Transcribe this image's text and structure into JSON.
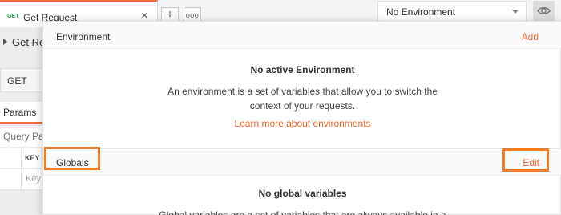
{
  "tab": {
    "method": "GET",
    "title": "Get Request",
    "close": "×",
    "add": "+",
    "more": "ooo"
  },
  "environment_selector": {
    "selected": "No Environment",
    "caret_icon": "caret-down-icon",
    "eye_icon": "eye-icon"
  },
  "request": {
    "name": "Get Req",
    "method": "GET",
    "params_tab": "Params",
    "query_params_label": "Query Par",
    "key_header": "KEY",
    "key_placeholder": "Key"
  },
  "popup": {
    "environment": {
      "title": "Environment",
      "action": "Add",
      "empty_title": "No active Environment",
      "empty_description": "An environment is a set of variables that allow you to switch the context of your requests.",
      "learn_more": "Learn more about environments"
    },
    "globals": {
      "title": "Globals",
      "action": "Edit",
      "empty_title": "No global variables",
      "empty_description": "Global variables are a set of variables that are always available in a"
    }
  },
  "colors": {
    "accent": "#f26b3a",
    "highlight": "#f07b29",
    "get_method": "#2e9b48"
  }
}
